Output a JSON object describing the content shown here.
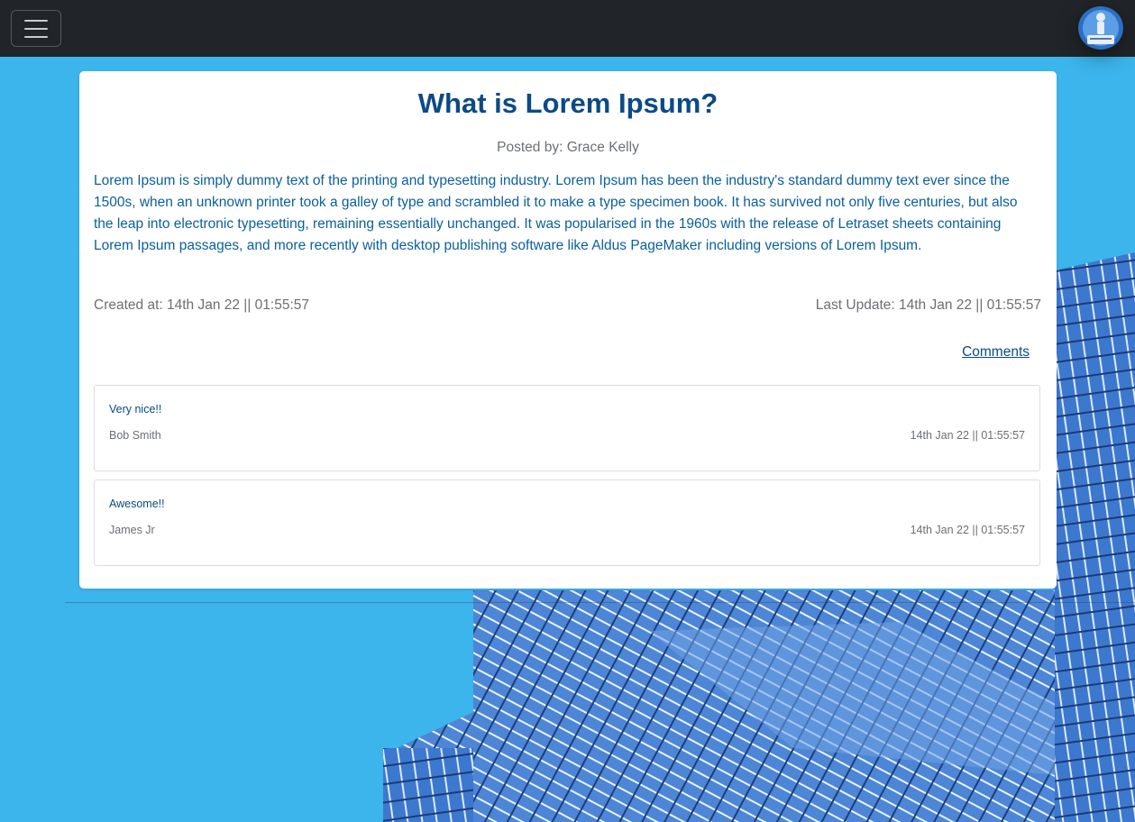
{
  "post": {
    "title": "What is Lorem Ipsum?",
    "posted_by": "Posted by: Grace Kelly",
    "body": "Lorem Ipsum is simply dummy text of the printing and typesetting industry. Lorem Ipsum has been the industry's standard dummy text ever since the 1500s, when an unknown printer took a galley of type and scrambled it to make a type specimen book. It has survived not only five centuries, but also the leap into electronic typesetting, remaining essentially unchanged. It was popularised in the 1960s with the release of Letraset sheets containing Lorem Ipsum passages, and more recently with desktop publishing software like Aldus PageMaker including versions of Lorem Ipsum.",
    "created_at": "Created at: 14th Jan 22 || 01:55:57",
    "last_update": "Last Update: 14th Jan 22 || 01:55:57",
    "comments_link": "Comments"
  },
  "comments": [
    {
      "text": "Very nice!!",
      "author": "Bob Smith",
      "date": "14th Jan 22 || 01:55:57"
    },
    {
      "text": "Awesome!!",
      "author": "James Jr",
      "date": "14th Jan 22 || 01:55:57"
    }
  ],
  "navbar": {
    "toggler_icon": "hamburger-menu-icon",
    "avatar": "user-avatar-image"
  },
  "colors": {
    "navbar_bg": "#212529",
    "title": "#0c4a86",
    "body_text": "#0a5f9d",
    "muted_text": "#6b6f73",
    "page_bg": "#3bb5ec"
  }
}
